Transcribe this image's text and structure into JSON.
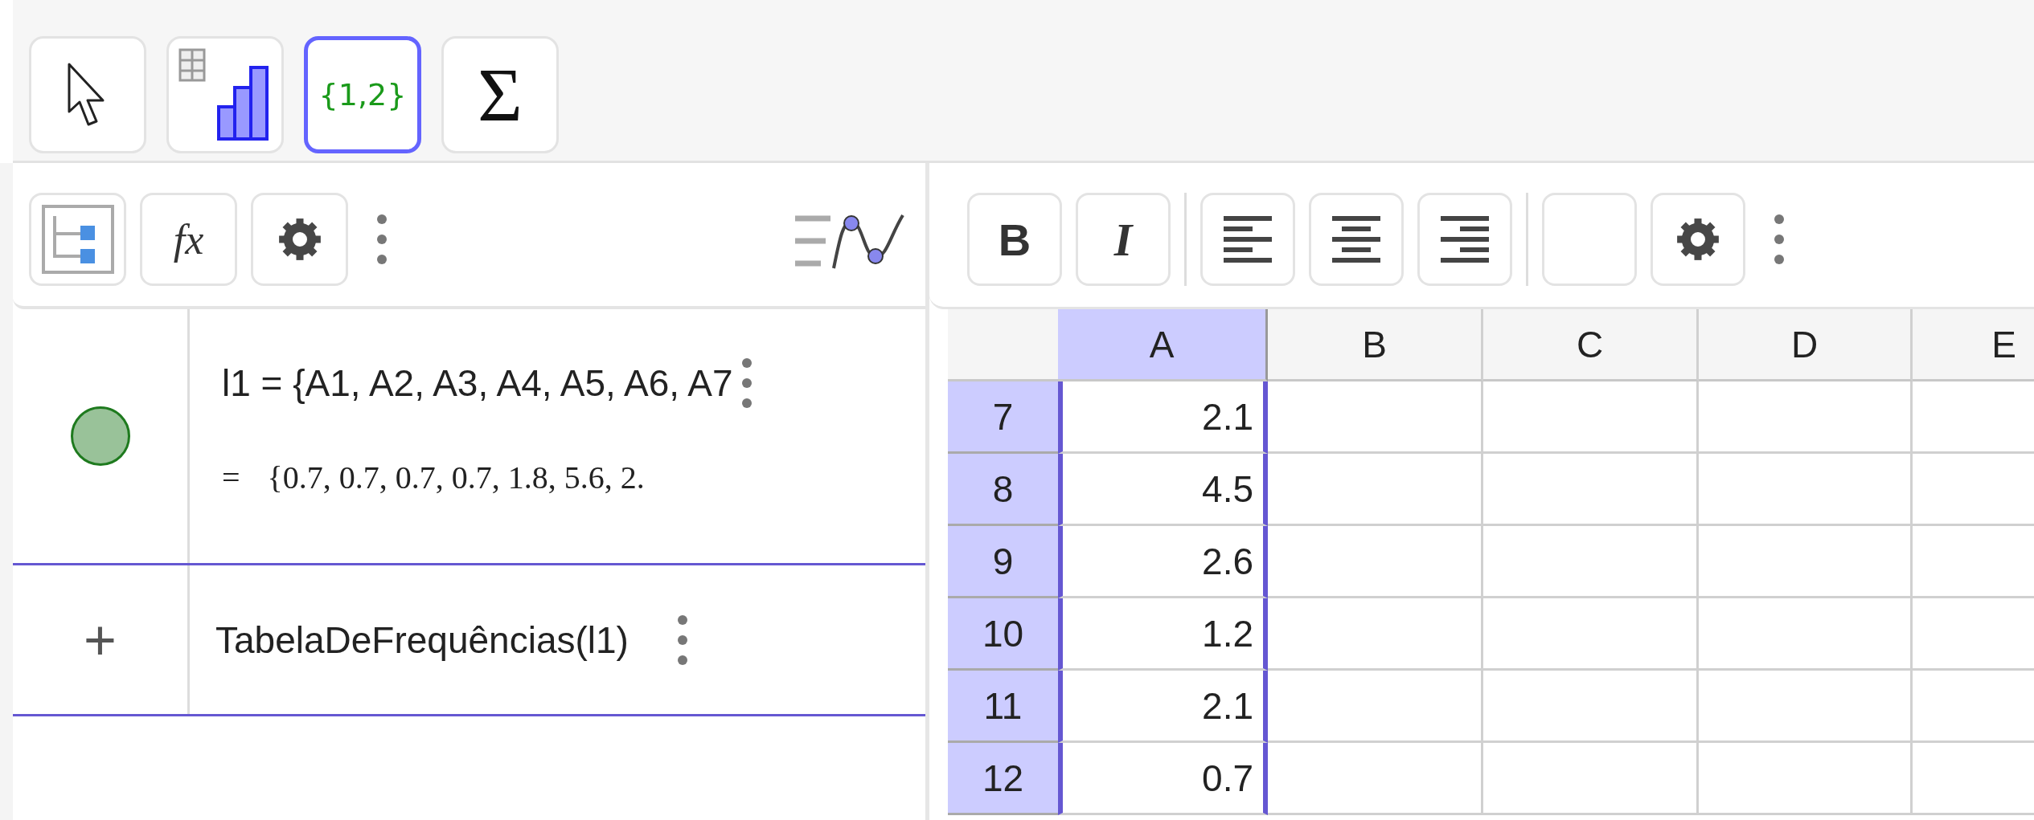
{
  "toolbar": {
    "tools": [
      {
        "kind": "move",
        "selected": false
      },
      {
        "kind": "histogram",
        "selected": false
      },
      {
        "kind": "list",
        "label": "{1,2}",
        "selected": true
      },
      {
        "kind": "sum",
        "label": "Σ",
        "selected": false
      }
    ]
  },
  "algebra": {
    "header": {
      "buttons": [
        {
          "kind": "tree"
        },
        {
          "kind": "function",
          "label": "fx"
        },
        {
          "kind": "settings"
        },
        {
          "kind": "more"
        }
      ]
    },
    "rows": [
      {
        "kind": "object",
        "visible": true,
        "definition": "l1 = {A1, A2, A3, A4, A5, A6, A7",
        "value_prefix": "=",
        "value": "{0.7, 0.7, 0.7, 0.7, 1.8, 5.6, 2."
      },
      {
        "kind": "input",
        "symbol": "+",
        "text": "TabelaDeFrequências(l1)"
      }
    ]
  },
  "spreadsheet": {
    "toolbar": {
      "groups": [
        [
          {
            "kind": "bold",
            "label": "B"
          },
          {
            "kind": "italic",
            "label": "I"
          }
        ],
        [
          {
            "kind": "align-left"
          },
          {
            "kind": "align-center"
          },
          {
            "kind": "align-right"
          }
        ],
        [
          {
            "kind": "color"
          },
          {
            "kind": "settings"
          },
          {
            "kind": "more"
          }
        ]
      ]
    },
    "columns": [
      {
        "label": "A",
        "selected": true
      },
      {
        "label": "B",
        "selected": false
      },
      {
        "label": "C",
        "selected": false
      },
      {
        "label": "D",
        "selected": false
      },
      {
        "label": "E",
        "selected": false
      }
    ],
    "rows": [
      {
        "label": "7",
        "selected": true,
        "cells": [
          "2.1"
        ]
      },
      {
        "label": "8",
        "selected": true,
        "cells": [
          "4.5"
        ]
      },
      {
        "label": "9",
        "selected": true,
        "cells": [
          "2.6"
        ]
      },
      {
        "label": "10",
        "selected": true,
        "cells": [
          "1.2"
        ]
      },
      {
        "label": "11",
        "selected": true,
        "cells": [
          "2.1"
        ]
      },
      {
        "label": "12",
        "selected": true,
        "cells": [
          "0.7"
        ]
      }
    ]
  }
}
